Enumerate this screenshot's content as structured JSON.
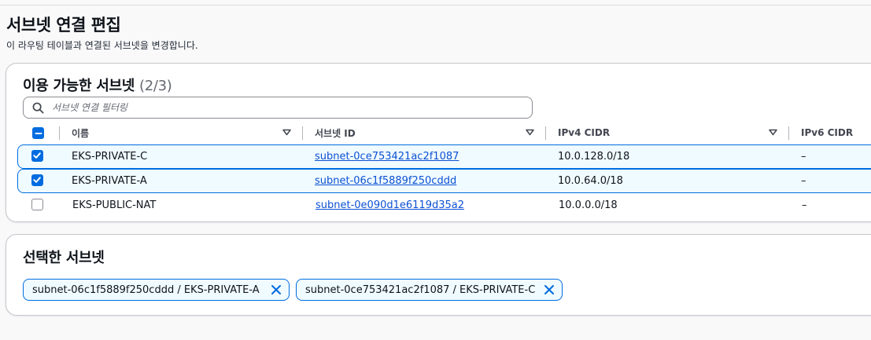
{
  "page": {
    "title": "서브넷 연결 편집",
    "description": "이 라우팅 테이블과 연결된 서브넷을 변경합니다."
  },
  "available": {
    "title": "이용 가능한 서브넷",
    "count": "(2/3)",
    "filter_placeholder": "서브넷 연결 필터링",
    "columns": {
      "name": "이름",
      "subnet_id": "서브넷 ID",
      "ipv4": "IPv4 CIDR",
      "ipv6": "IPv6 CIDR"
    },
    "rows": [
      {
        "checked": true,
        "name": "EKS-PRIVATE-C",
        "subnet_id": "subnet-0ce753421ac2f1087",
        "ipv4": "10.0.128.0/18",
        "ipv6": "–"
      },
      {
        "checked": true,
        "name": "EKS-PRIVATE-A",
        "subnet_id": "subnet-06c1f5889f250cddd",
        "ipv4": "10.0.64.0/18",
        "ipv6": "–"
      },
      {
        "checked": false,
        "name": "EKS-PUBLIC-NAT",
        "subnet_id": "subnet-0e090d1e6119d35a2",
        "ipv4": "10.0.0.0/18",
        "ipv6": "–"
      }
    ]
  },
  "selected": {
    "title": "선택한 서브넷",
    "tokens": [
      "subnet-06c1f5889f250cddd / EKS-PRIVATE-A",
      "subnet-0ce753421ac2f1087 / EKS-PRIVATE-C"
    ]
  },
  "icons": {
    "search": "search-icon",
    "sort": "caret-down-icon",
    "remove": "close-icon",
    "select_all": "indeterminate-checkbox"
  },
  "colors": {
    "accent": "#006ce0",
    "link": "#0c51d3",
    "selected_row_bg": "#f0fbff"
  }
}
